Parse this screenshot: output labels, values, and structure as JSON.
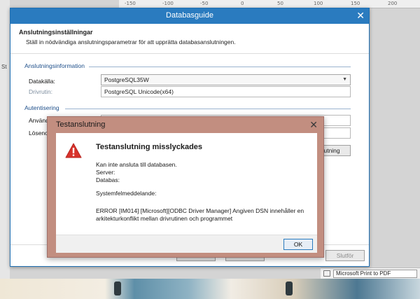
{
  "background": {
    "ruler_ticks": [
      "-150",
      "-100",
      "-50",
      "0",
      "50",
      "100",
      "150",
      "200"
    ],
    "side_letter": "St",
    "printer_select": "Microsoft Print to PDF"
  },
  "wizard": {
    "title": "Databasguide",
    "header_title": "Anslutningsinställningar",
    "header_subtitle": "Ställ in nödvändiga anslutningsparametrar för att upprätta databasanslutningen.",
    "connection_group": "Anslutningsinformation",
    "datasource_label": "Datakälla:",
    "datasource_value": "PostgreSQL35W",
    "driver_label": "Drivrutin:",
    "driver_value": "PostgreSQL Unicode(x64)",
    "auth_group": "Autentisering",
    "username_label": "Användar",
    "password_label": "Lösenord",
    "test_button": "slutning",
    "footer_buttons": [
      "",
      "",
      "Slutför"
    ]
  },
  "dialog": {
    "title": "Testanslutning",
    "heading": "Testanslutning misslyckades",
    "lines": [
      "Kan inte ansluta till databasen.",
      "Server:",
      "Databas:",
      "",
      "Systemfelmeddelande:",
      "",
      "ERROR [IM014] [Microsoft][ODBC Driver Manager] Angiven DSN innehåller en",
      "arkitekturkonflikt mellan drivrutinen och programmet"
    ],
    "ok_label": "OK"
  },
  "colors": {
    "titlebar": "#2a7bbf",
    "dialog_frame": "#c28e80",
    "warning": "#d8322b",
    "group_label": "#1e4f8a"
  }
}
